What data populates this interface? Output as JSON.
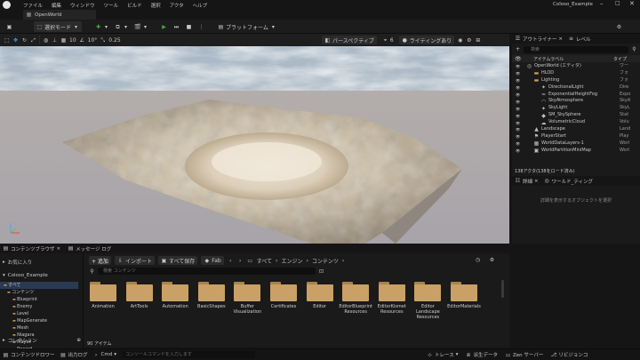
{
  "title": {
    "project": "Coloso_Example",
    "menus": [
      "ファイル",
      "編集",
      "ウィンドウ",
      "ツール",
      "ビルド",
      "選択",
      "アクタ",
      "ヘルプ"
    ]
  },
  "tab": {
    "label": "OpenWorld"
  },
  "toolbar": {
    "save_icon": "save-icon",
    "mode_label": "選択モード",
    "platform_label": "プラットフォーム",
    "play_color": "#3fae3f"
  },
  "viewport": {
    "snap_angle": "10°",
    "snap_scale": "0.25",
    "grid_size": "10",
    "speed": "6",
    "perspective": "パースペクティブ",
    "lit": "ライティングあり"
  },
  "outliner": {
    "tab_label": "アウトライナー",
    "tab2_label": "レベル",
    "search_placeholder": "検索",
    "col_label": "アイテムラベル",
    "col_type": "タイプ",
    "rows": [
      {
        "label": "OpenWorld (エディタ)",
        "type": "ワー"
      },
      {
        "label": "HLOD",
        "type": "フォ"
      },
      {
        "label": "Lighting",
        "type": "フォ"
      },
      {
        "label": "DirectionalLight",
        "type": "Dire"
      },
      {
        "label": "ExponentialHeightFog",
        "type": "Expo"
      },
      {
        "label": "SkyAtmosphere",
        "type": "SkyA"
      },
      {
        "label": "SkyLight",
        "type": "SkyL"
      },
      {
        "label": "SM_SkySphere",
        "type": "Stat"
      },
      {
        "label": "VolumetricCloud",
        "type": "Volu"
      },
      {
        "label": "Landscape",
        "type": "Land"
      },
      {
        "label": "PlayerStart",
        "type": "Play"
      },
      {
        "label": "WorldDataLayers-1",
        "type": "Worl"
      },
      {
        "label": "WorldPartitionMiniMap",
        "type": "Worl"
      }
    ],
    "status": "138アクタ(138をロード済み)"
  },
  "details": {
    "tab_label": "詳細",
    "tab2_label": "ワールド_ティング",
    "empty_text": "詳細を表示するオブジェクトを選択"
  },
  "content_browser": {
    "tab_label": "コンテンツブラウザ",
    "tab2_label": "メッセージ ログ",
    "add_label": "+ 追加",
    "import_label": "インポート",
    "save_all_label": "すべて保存",
    "fab_label": "Fab",
    "breadcrumb": [
      "すべて",
      "エンジン",
      "コンテンツ"
    ],
    "favorites_label": "お気に入り",
    "project_label": "Coloso_Example",
    "tree": [
      "すべて",
      "コンテンツ",
      "Blueprint",
      "Enemy",
      "Level",
      "MapGenerate",
      "Mesh",
      "Niagara",
      "Player",
      "Record"
    ],
    "collection_label": "コレクション",
    "search_placeholder": "検索 コンテンツ",
    "folders": [
      "Animation",
      "ArtTools",
      "Automation",
      "BasicShapes",
      "Buffer Visualization",
      "Certificates",
      "Editor",
      "EditorBlueprint Resources",
      "EditorKismet Resources",
      "Editor Landscape Resources",
      "EditorMaterials"
    ],
    "item_count": "90 アイテム"
  },
  "statusbar": {
    "drawer_label": "コンテンツドロワー",
    "log_label": "出力ログ",
    "cmd_label": "Cmd",
    "cmd_placeholder": "コンソールコマンドを入力します",
    "trace_label": "トレース",
    "derived_label": "派生データ",
    "zen_label": "Zen サーバー",
    "revision_label": "リビジョンコ"
  }
}
